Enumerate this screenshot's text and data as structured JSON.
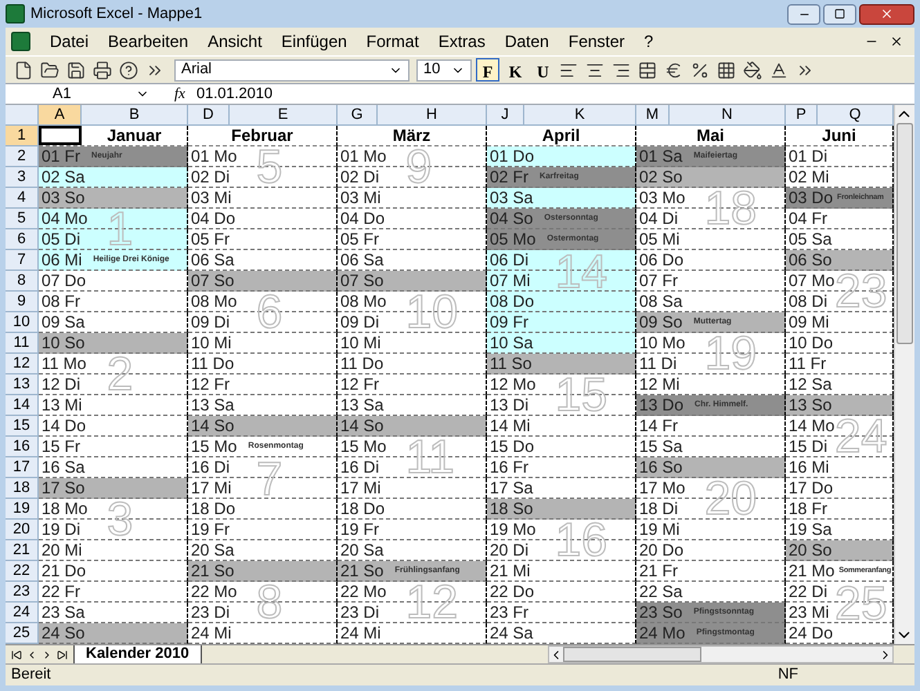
{
  "window": {
    "title": "Microsoft Excel - Mappe1"
  },
  "menu": [
    "Datei",
    "Bearbeiten",
    "Ansicht",
    "Einfügen",
    "Format",
    "Extras",
    "Daten",
    "Fenster",
    "?"
  ],
  "toolbar": {
    "font": "Arial",
    "size": "10",
    "styles": [
      {
        "label": "F",
        "on": true
      },
      {
        "label": "K",
        "on": false
      },
      {
        "label": "U",
        "on": false
      }
    ]
  },
  "formula_bar": {
    "name_box": "A1",
    "fx": "fx",
    "value": "01.01.2010"
  },
  "column_headers": [
    {
      "label": "A",
      "selected": true
    },
    {
      "label": "B",
      "selected": false
    },
    {
      "label": "D",
      "selected": false
    },
    {
      "label": "E",
      "selected": false
    },
    {
      "label": "G",
      "selected": false
    },
    {
      "label": "H",
      "selected": false
    },
    {
      "label": "J",
      "selected": false
    },
    {
      "label": "K",
      "selected": false
    },
    {
      "label": "M",
      "selected": false
    },
    {
      "label": "N",
      "selected": false
    },
    {
      "label": "P",
      "selected": false
    },
    {
      "label": "Q",
      "selected": false
    }
  ],
  "row_headers": [
    {
      "label": "1",
      "selected": true
    },
    {
      "label": "2",
      "selected": false
    },
    {
      "label": "3",
      "selected": false
    },
    {
      "label": "4",
      "selected": false
    },
    {
      "label": "5",
      "selected": false
    },
    {
      "label": "6",
      "selected": false
    },
    {
      "label": "7",
      "selected": false
    },
    {
      "label": "8",
      "selected": false
    },
    {
      "label": "9",
      "selected": false
    },
    {
      "label": "10",
      "selected": false
    },
    {
      "label": "11",
      "selected": false
    },
    {
      "label": "12",
      "selected": false
    },
    {
      "label": "13",
      "selected": false
    },
    {
      "label": "14",
      "selected": false
    },
    {
      "label": "15",
      "selected": false
    },
    {
      "label": "16",
      "selected": false
    },
    {
      "label": "17",
      "selected": false
    },
    {
      "label": "18",
      "selected": false
    },
    {
      "label": "19",
      "selected": false
    },
    {
      "label": "20",
      "selected": false
    },
    {
      "label": "21",
      "selected": false
    },
    {
      "label": "22",
      "selected": false
    },
    {
      "label": "23",
      "selected": false
    },
    {
      "label": "24",
      "selected": false
    },
    {
      "label": "25",
      "selected": false
    }
  ],
  "months": [
    {
      "name": "Januar",
      "days": [
        {
          "label": "01 Fr",
          "kind": "holiday",
          "note": "Neujahr"
        },
        {
          "label": "02 Sa",
          "kind": "vacation"
        },
        {
          "label": "03 So",
          "kind": "sunday"
        },
        {
          "label": "04 Mo",
          "kind": "vacation",
          "week": "1"
        },
        {
          "label": "05 Di",
          "kind": "vacation"
        },
        {
          "label": "06 Mi",
          "kind": "vacation",
          "note": "Heilige Drei Könige"
        },
        {
          "label": "07 Do",
          "kind": "workday"
        },
        {
          "label": "08 Fr",
          "kind": "workday"
        },
        {
          "label": "09 Sa",
          "kind": "workday"
        },
        {
          "label": "10 So",
          "kind": "sunday"
        },
        {
          "label": "11 Mo",
          "kind": "workday",
          "week": "2"
        },
        {
          "label": "12 Di",
          "kind": "workday"
        },
        {
          "label": "13 Mi",
          "kind": "workday"
        },
        {
          "label": "14 Do",
          "kind": "workday"
        },
        {
          "label": "15 Fr",
          "kind": "workday"
        },
        {
          "label": "16 Sa",
          "kind": "workday"
        },
        {
          "label": "17 So",
          "kind": "sunday"
        },
        {
          "label": "18 Mo",
          "kind": "workday",
          "week": "3"
        },
        {
          "label": "19 Di",
          "kind": "workday"
        },
        {
          "label": "20 Mi",
          "kind": "workday"
        },
        {
          "label": "21 Do",
          "kind": "workday"
        },
        {
          "label": "22 Fr",
          "kind": "workday"
        },
        {
          "label": "23 Sa",
          "kind": "workday"
        },
        {
          "label": "24 So",
          "kind": "sunday"
        }
      ]
    },
    {
      "name": "Februar",
      "days": [
        {
          "label": "01 Mo",
          "kind": "workday",
          "week": "5"
        },
        {
          "label": "02 Di",
          "kind": "workday"
        },
        {
          "label": "03 Mi",
          "kind": "workday"
        },
        {
          "label": "04 Do",
          "kind": "workday"
        },
        {
          "label": "05 Fr",
          "kind": "workday"
        },
        {
          "label": "06 Sa",
          "kind": "workday"
        },
        {
          "label": "07 So",
          "kind": "sunday"
        },
        {
          "label": "08 Mo",
          "kind": "workday",
          "week": "6"
        },
        {
          "label": "09 Di",
          "kind": "workday"
        },
        {
          "label": "10 Mi",
          "kind": "workday"
        },
        {
          "label": "11 Do",
          "kind": "workday"
        },
        {
          "label": "12 Fr",
          "kind": "workday"
        },
        {
          "label": "13 Sa",
          "kind": "workday"
        },
        {
          "label": "14 So",
          "kind": "sunday"
        },
        {
          "label": "15 Mo",
          "kind": "workday",
          "week": "7",
          "note": "Rosenmontag"
        },
        {
          "label": "16 Di",
          "kind": "workday"
        },
        {
          "label": "17 Mi",
          "kind": "workday"
        },
        {
          "label": "18 Do",
          "kind": "workday"
        },
        {
          "label": "19 Fr",
          "kind": "workday"
        },
        {
          "label": "20 Sa",
          "kind": "workday"
        },
        {
          "label": "21 So",
          "kind": "sunday"
        },
        {
          "label": "22 Mo",
          "kind": "workday",
          "week": "8"
        },
        {
          "label": "23 Di",
          "kind": "workday"
        },
        {
          "label": "24 Mi",
          "kind": "workday"
        }
      ]
    },
    {
      "name": "März",
      "days": [
        {
          "label": "01 Mo",
          "kind": "workday",
          "week": "9"
        },
        {
          "label": "02 Di",
          "kind": "workday"
        },
        {
          "label": "03 Mi",
          "kind": "workday"
        },
        {
          "label": "04 Do",
          "kind": "workday"
        },
        {
          "label": "05 Fr",
          "kind": "workday"
        },
        {
          "label": "06 Sa",
          "kind": "workday"
        },
        {
          "label": "07 So",
          "kind": "sunday"
        },
        {
          "label": "08 Mo",
          "kind": "workday",
          "week": "10"
        },
        {
          "label": "09 Di",
          "kind": "workday"
        },
        {
          "label": "10 Mi",
          "kind": "workday"
        },
        {
          "label": "11 Do",
          "kind": "workday"
        },
        {
          "label": "12 Fr",
          "kind": "workday"
        },
        {
          "label": "13 Sa",
          "kind": "workday"
        },
        {
          "label": "14 So",
          "kind": "sunday"
        },
        {
          "label": "15 Mo",
          "kind": "workday",
          "week": "11"
        },
        {
          "label": "16 Di",
          "kind": "workday"
        },
        {
          "label": "17 Mi",
          "kind": "workday"
        },
        {
          "label": "18 Do",
          "kind": "workday"
        },
        {
          "label": "19 Fr",
          "kind": "workday"
        },
        {
          "label": "20 Sa",
          "kind": "workday"
        },
        {
          "label": "21 So",
          "kind": "sunday",
          "note": "Frühlingsanfang"
        },
        {
          "label": "22 Mo",
          "kind": "workday",
          "week": "12"
        },
        {
          "label": "23 Di",
          "kind": "workday"
        },
        {
          "label": "24 Mi",
          "kind": "workday"
        }
      ]
    },
    {
      "name": "April",
      "days": [
        {
          "label": "01 Do",
          "kind": "vacation"
        },
        {
          "label": "02 Fr",
          "kind": "holiday",
          "note": "Karfreitag"
        },
        {
          "label": "03 Sa",
          "kind": "vacation"
        },
        {
          "label": "04 So",
          "kind": "holiday",
          "note": "Ostersonntag"
        },
        {
          "label": "05 Mo",
          "kind": "holiday",
          "week": "14",
          "note": "Ostermontag"
        },
        {
          "label": "06 Di",
          "kind": "vacation"
        },
        {
          "label": "07 Mi",
          "kind": "vacation"
        },
        {
          "label": "08 Do",
          "kind": "vacation"
        },
        {
          "label": "09 Fr",
          "kind": "vacation"
        },
        {
          "label": "10 Sa",
          "kind": "vacation"
        },
        {
          "label": "11 So",
          "kind": "sunday"
        },
        {
          "label": "12 Mo",
          "kind": "workday",
          "week": "15"
        },
        {
          "label": "13 Di",
          "kind": "workday"
        },
        {
          "label": "14 Mi",
          "kind": "workday"
        },
        {
          "label": "15 Do",
          "kind": "workday"
        },
        {
          "label": "16 Fr",
          "kind": "workday"
        },
        {
          "label": "17 Sa",
          "kind": "workday"
        },
        {
          "label": "18 So",
          "kind": "sunday"
        },
        {
          "label": "19 Mo",
          "kind": "workday",
          "week": "16"
        },
        {
          "label": "20 Di",
          "kind": "workday"
        },
        {
          "label": "21 Mi",
          "kind": "workday"
        },
        {
          "label": "22 Do",
          "kind": "workday"
        },
        {
          "label": "23 Fr",
          "kind": "workday"
        },
        {
          "label": "24 Sa",
          "kind": "workday"
        }
      ]
    },
    {
      "name": "Mai",
      "days": [
        {
          "label": "01 Sa",
          "kind": "holiday",
          "note": "Maifeiertag"
        },
        {
          "label": "02 So",
          "kind": "sunday"
        },
        {
          "label": "03 Mo",
          "kind": "workday",
          "week": "18"
        },
        {
          "label": "04 Di",
          "kind": "workday"
        },
        {
          "label": "05 Mi",
          "kind": "workday"
        },
        {
          "label": "06 Do",
          "kind": "workday"
        },
        {
          "label": "07 Fr",
          "kind": "workday"
        },
        {
          "label": "08 Sa",
          "kind": "workday"
        },
        {
          "label": "09 So",
          "kind": "sunday",
          "note": "Muttertag"
        },
        {
          "label": "10 Mo",
          "kind": "workday",
          "week": "19"
        },
        {
          "label": "11 Di",
          "kind": "workday"
        },
        {
          "label": "12 Mi",
          "kind": "workday"
        },
        {
          "label": "13 Do",
          "kind": "holiday",
          "note": "Chr. Himmelf."
        },
        {
          "label": "14 Fr",
          "kind": "workday"
        },
        {
          "label": "15 Sa",
          "kind": "workday"
        },
        {
          "label": "16 So",
          "kind": "sunday"
        },
        {
          "label": "17 Mo",
          "kind": "workday",
          "week": "20"
        },
        {
          "label": "18 Di",
          "kind": "workday"
        },
        {
          "label": "19 Mi",
          "kind": "workday"
        },
        {
          "label": "20 Do",
          "kind": "workday"
        },
        {
          "label": "21 Fr",
          "kind": "workday"
        },
        {
          "label": "22 Sa",
          "kind": "workday"
        },
        {
          "label": "23 So",
          "kind": "holiday",
          "note": "Pfingstsonntag"
        },
        {
          "label": "24 Mo",
          "kind": "holiday",
          "note": "Pfingstmontag"
        }
      ]
    },
    {
      "name": "Juni",
      "days": [
        {
          "label": "01 Di",
          "kind": "workday"
        },
        {
          "label": "02 Mi",
          "kind": "workday"
        },
        {
          "label": "03 Do",
          "kind": "holiday",
          "note": "Fronleichnam"
        },
        {
          "label": "04 Fr",
          "kind": "workday"
        },
        {
          "label": "05 Sa",
          "kind": "workday"
        },
        {
          "label": "06 So",
          "kind": "sunday"
        },
        {
          "label": "07 Mo",
          "kind": "workday",
          "week": "23"
        },
        {
          "label": "08 Di",
          "kind": "workday"
        },
        {
          "label": "09 Mi",
          "kind": "workday"
        },
        {
          "label": "10 Do",
          "kind": "workday"
        },
        {
          "label": "11 Fr",
          "kind": "workday"
        },
        {
          "label": "12 Sa",
          "kind": "workday"
        },
        {
          "label": "13 So",
          "kind": "sunday"
        },
        {
          "label": "14 Mo",
          "kind": "workday",
          "week": "24"
        },
        {
          "label": "15 Di",
          "kind": "workday"
        },
        {
          "label": "16 Mi",
          "kind": "workday"
        },
        {
          "label": "17 Do",
          "kind": "workday"
        },
        {
          "label": "18 Fr",
          "kind": "workday"
        },
        {
          "label": "19 Sa",
          "kind": "workday"
        },
        {
          "label": "20 So",
          "kind": "sunday"
        },
        {
          "label": "21 Mo",
          "kind": "workday",
          "week": "25",
          "note": "Sommeranfang"
        },
        {
          "label": "22 Di",
          "kind": "workday"
        },
        {
          "label": "23 Mi",
          "kind": "workday"
        },
        {
          "label": "24 Do",
          "kind": "workday"
        }
      ]
    }
  ],
  "sheet_tabs": [
    {
      "label": "Kalender 2010",
      "selected": true
    }
  ],
  "status_bar": {
    "left": "Bereit",
    "right": "NF"
  }
}
